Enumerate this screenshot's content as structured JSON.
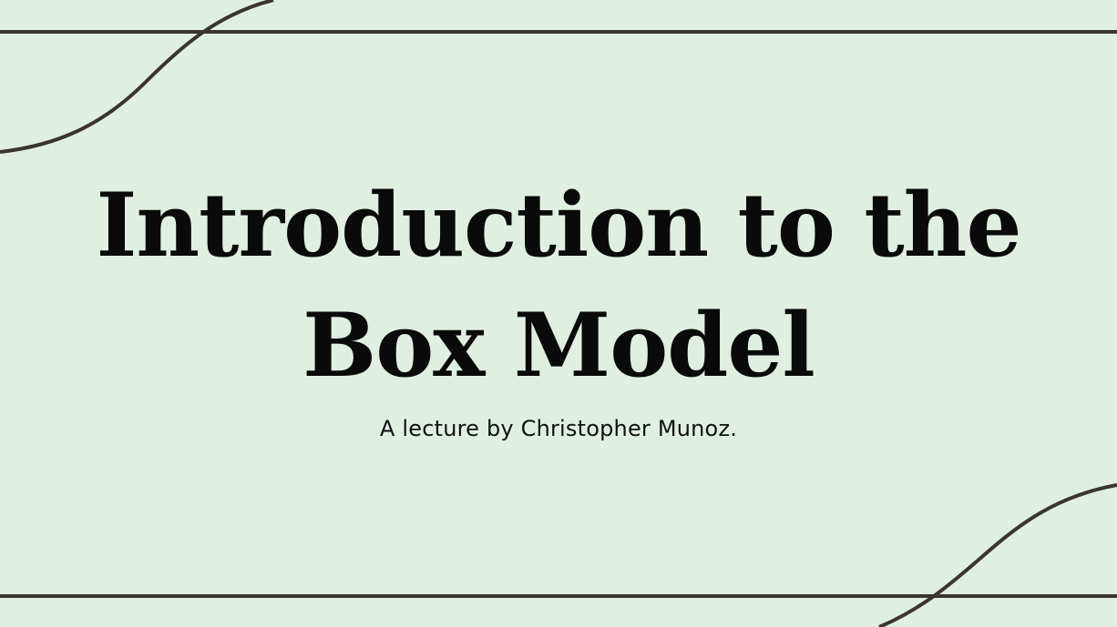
{
  "slide": {
    "title_line_1": "Introduction to the",
    "title_line_2": "Box Model",
    "subtitle": "A lecture by Christopher Munoz."
  },
  "colors": {
    "background": "#e1efe2",
    "line": "#3a3530",
    "text": "#0a0a0a"
  }
}
